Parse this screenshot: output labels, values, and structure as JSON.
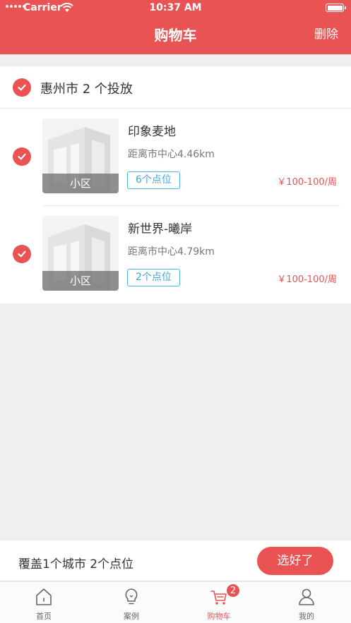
{
  "status_bar": {
    "carrier": "Carrier",
    "time": "10:37 AM"
  },
  "nav": {
    "title": "购物车",
    "right_action": "删除"
  },
  "cart": {
    "city_group": {
      "label": "惠州市  2 个投放",
      "checked": true
    },
    "items": [
      {
        "name": "印象麦地",
        "distance": "距离市中心4.46km",
        "points": "6个点位",
        "price": "￥100-100/周",
        "thumb_tag": "小区",
        "checked": true
      },
      {
        "name": "新世界-曦岸",
        "distance": "距离市中心4.79km",
        "points": "2个点位",
        "price": "￥100-100/周",
        "thumb_tag": "小区",
        "checked": true
      }
    ]
  },
  "bottom_bar": {
    "summary": "覆盖1个城市 2个点位",
    "confirm_label": "选好了"
  },
  "tabbar": {
    "tabs": [
      {
        "label": "首页",
        "icon": "home-icon",
        "active": false
      },
      {
        "label": "案例",
        "icon": "lightbulb-icon",
        "active": false
      },
      {
        "label": "购物车",
        "icon": "cart-icon",
        "active": true,
        "badge": "2"
      },
      {
        "label": "我的",
        "icon": "user-icon",
        "active": false
      }
    ]
  },
  "colors": {
    "brand": "#e95353",
    "points_border": "#4db6e8"
  }
}
